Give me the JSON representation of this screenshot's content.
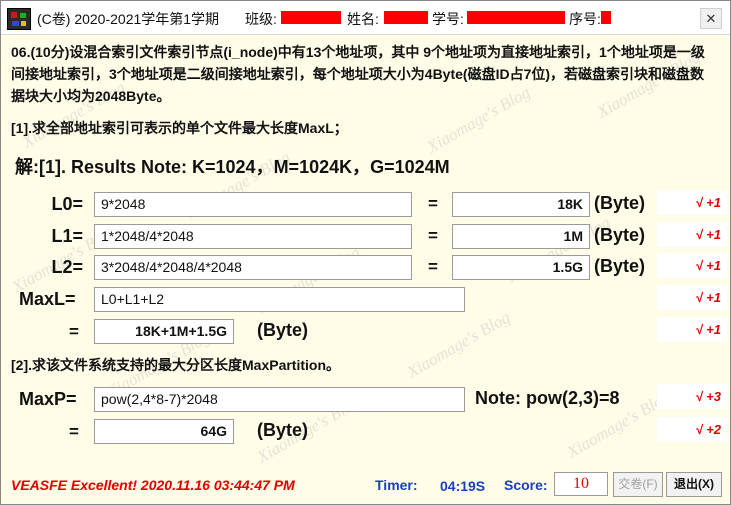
{
  "titlebar": {
    "exam": "(C卷) 2020-2021学年第1学期",
    "class_label": "班级:",
    "name_label": "姓名:",
    "student_id_label": "学号:",
    "seq_label": "序号:",
    "close_symbol": "✕"
  },
  "watermark_text": "Xiaomage's Blog",
  "question": {
    "text": "06.(10分)设混合索引文件索引节点(i_node)中有13个地址项，其中 9个地址项为直接地址索引，1个地址项是一级间接地址索引，3个地址项是二级间接地址索引，每个地址项大小为4Byte(磁盘ID占7位)，若磁盘索引块和磁盘数据块大小均为2048Byte。",
    "part1": "[1].求全部地址索引可表示的单个文件最大长度MaxL；",
    "part2": "[2].求该文件系统支持的最大分区长度MaxPartition。"
  },
  "solution": {
    "header": "解:[1]. Results Note: K=1024，M=1024K，G=1024M",
    "equals": "=",
    "rows": [
      {
        "label": "L0=",
        "expr": "9*2048",
        "result": "18K",
        "unit": "(Byte)",
        "score": "√ +1"
      },
      {
        "label": "L1=",
        "expr": "1*2048/4*2048",
        "result": "1M",
        "unit": "(Byte)",
        "score": "√ +1"
      },
      {
        "label": "L2=",
        "expr": "3*2048/4*2048/4*2048",
        "result": "1.5G",
        "unit": "(Byte)",
        "score": "√ +1"
      }
    ],
    "maxl": {
      "label": "MaxL=",
      "expr": "L0+L1+L2",
      "score": "√ +1"
    },
    "maxl_result": {
      "label": "=",
      "value": "18K+1M+1.5G",
      "unit": "(Byte)",
      "score": "√ +1"
    },
    "maxp": {
      "label": "MaxP=",
      "expr": "pow(2,4*8-7)*2048",
      "note": "Note: pow(2,3)=8",
      "score": "√ +3"
    },
    "maxp_result": {
      "label": "=",
      "value": "64G",
      "unit": "(Byte)",
      "score": "√ +2"
    }
  },
  "footer": {
    "message": "VEASFE Excellent! 2020.11.16 03:44:47 PM",
    "timer_label": "Timer:",
    "timer_value": "04:19S",
    "score_label": "Score:",
    "score_value": "10",
    "submit_button": "交卷(F)",
    "exit_button": "退出(X)"
  },
  "colors": {
    "redaction": "#ff0000",
    "score_text": "#e00000",
    "status_blue": "#1a3ec0",
    "background": "#fffde8"
  }
}
